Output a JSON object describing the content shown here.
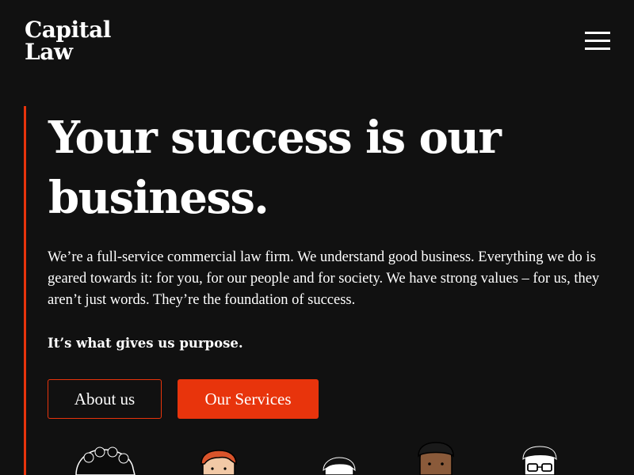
{
  "brand": {
    "logo_line1": "Capital",
    "logo_line2": "Law",
    "accent_color": "#e8340c",
    "background_color": "#111111"
  },
  "header": {
    "menu_icon": "hamburger-menu-icon"
  },
  "hero": {
    "headline": "Your success is our business.",
    "intro": "We’re a full-service commercial law firm. We understand good business. Everything we do is geared towards it: for you, for our people and for society. We have strong values – for us, they aren’t just words. They’re the foundation of success.",
    "tagline": "It’s what gives us purpose.",
    "buttons": {
      "about_label": "About us",
      "services_label": "Our Services"
    }
  },
  "illustrations": {
    "people": [
      "curly-hair-person-illustration",
      "red-hair-person-illustration",
      "dark-hair-person-illustration",
      "short-hair-person-illustration",
      "glasses-person-illustration"
    ]
  }
}
